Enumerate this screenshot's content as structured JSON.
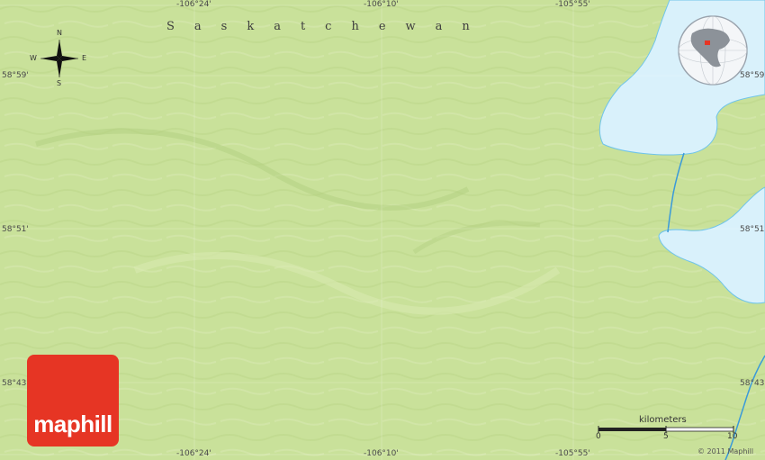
{
  "map": {
    "region_label": "Saskatchewan",
    "top_longitudes": [
      "-106°24'",
      "-106°10'",
      "-105°55'"
    ],
    "bottom_longitudes": [
      "-106°24'",
      "-106°10'",
      "-105°55'"
    ],
    "left_latitudes": [
      "58°59'",
      "58°51'",
      "58°43'"
    ],
    "right_latitudes": [
      "58°59'",
      "58°51'",
      "58°43'"
    ],
    "compass": {
      "n": "N",
      "s": "S",
      "e": "E",
      "w": "W"
    },
    "scale": {
      "title": "kilometers",
      "labels": [
        "0",
        "5",
        "10"
      ]
    },
    "brand": "maphill",
    "copyright": "© 2011 Maphill",
    "colors": {
      "land": "#c9e19a",
      "water": "#d9f1fb",
      "river": "#3a9ad9",
      "brand": "#e63524"
    }
  }
}
